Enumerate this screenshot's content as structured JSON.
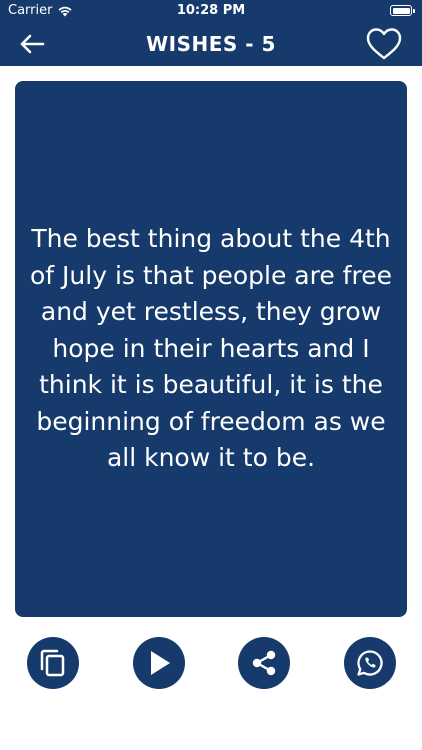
{
  "status_bar": {
    "carrier": "Carrier",
    "time": "10:28 PM"
  },
  "nav": {
    "title": "WISHES - 5"
  },
  "wish": {
    "text": "The best thing about the 4th of July is that people are free and yet restless, they grow hope in their hearts and I think it is beautiful, it is the beginning of freedom as we all know it to be."
  },
  "actions": [
    "copy-icon",
    "play-icon",
    "share-icon",
    "whatsapp-icon"
  ],
  "colors": {
    "primary": "#163a6b",
    "background": "#ffffff",
    "text_on_primary": "#ffffff"
  }
}
